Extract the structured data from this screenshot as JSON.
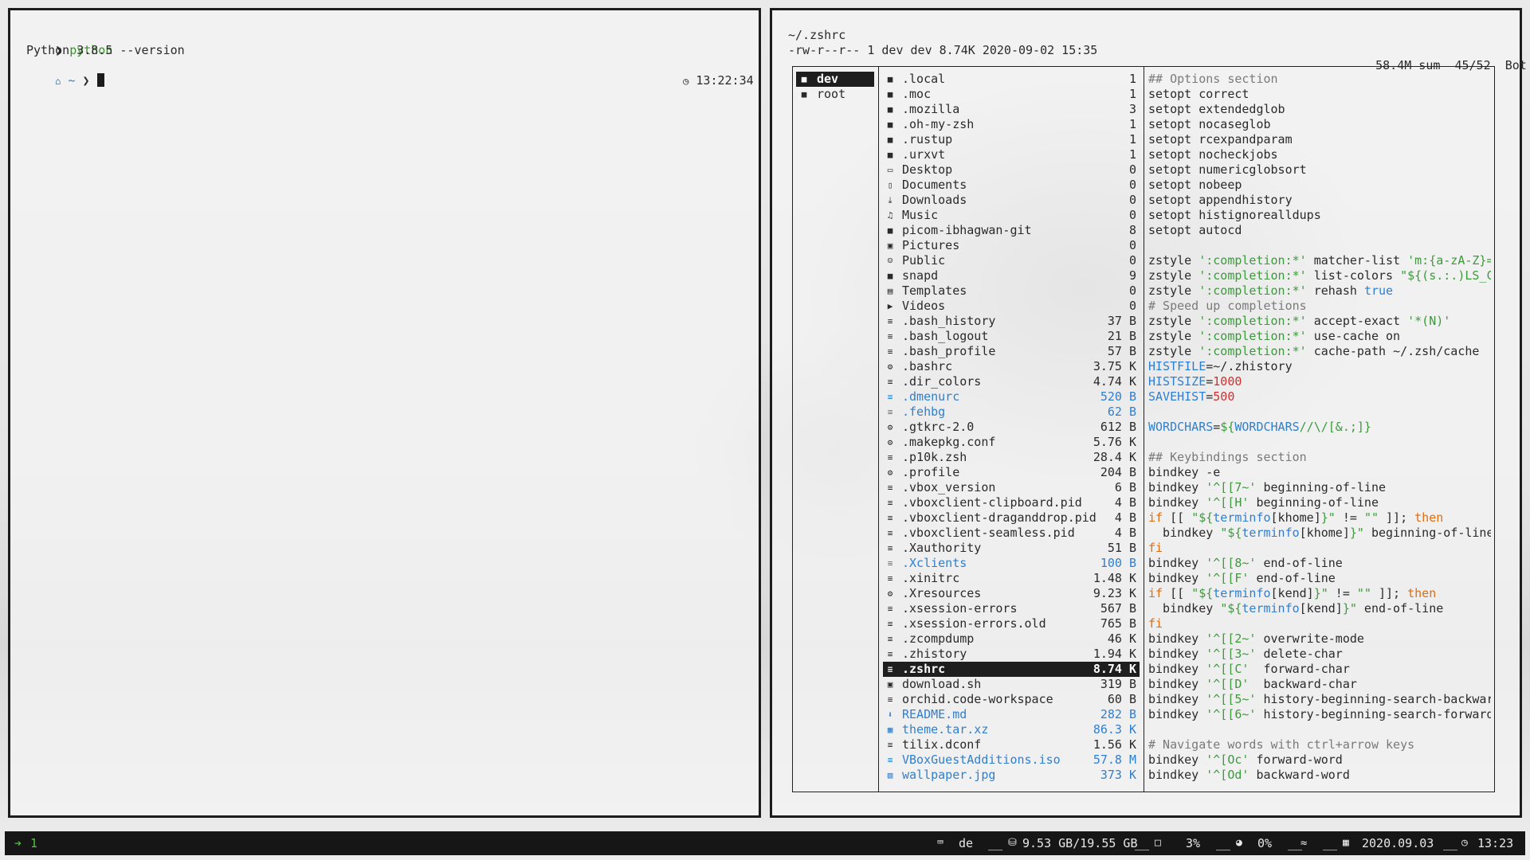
{
  "left_terminal": {
    "prompt_symbol": "❯",
    "command_name": "python",
    "command_args": " --version",
    "output": "Python 3.8.5",
    "home_icon": "home-icon",
    "cwd": "~",
    "clock_icon": "clock-icon",
    "time": "13:22:34"
  },
  "ranger": {
    "path": "~/.zshrc",
    "file_info": "-rw-r--r-- 1 dev dev 8.74K 2020-09-02 15:35",
    "disk_usage": "58.4M sum",
    "position": "45/52",
    "scroll": "Bot",
    "parent_dirs": [
      {
        "name": "dev",
        "selected": true
      },
      {
        "name": "root",
        "selected": false
      }
    ],
    "files": [
      {
        "icon": "folder-icon",
        "name": ".local",
        "size": "1",
        "link": false
      },
      {
        "icon": "folder-icon",
        "name": ".moc",
        "size": "1",
        "link": false
      },
      {
        "icon": "folder-icon",
        "name": ".mozilla",
        "size": "3",
        "link": false
      },
      {
        "icon": "folder-icon",
        "name": ".oh-my-zsh",
        "size": "1",
        "link": false
      },
      {
        "icon": "folder-icon",
        "name": ".rustup",
        "size": "1",
        "link": false
      },
      {
        "icon": "folder-icon",
        "name": ".urxvt",
        "size": "1",
        "link": false
      },
      {
        "icon": "desktop-icon",
        "name": "Desktop",
        "size": "0",
        "link": false
      },
      {
        "icon": "documents-icon",
        "name": "Documents",
        "size": "0",
        "link": false
      },
      {
        "icon": "download-icon",
        "name": "Downloads",
        "size": "0",
        "link": false
      },
      {
        "icon": "music-icon",
        "name": "Music",
        "size": "0",
        "link": false
      },
      {
        "icon": "folder-icon",
        "name": "picom-ibhagwan-git",
        "size": "8",
        "link": false
      },
      {
        "icon": "pictures-icon",
        "name": "Pictures",
        "size": "0",
        "link": false
      },
      {
        "icon": "users-icon",
        "name": "Public",
        "size": "0",
        "link": false
      },
      {
        "icon": "folder-icon",
        "name": "snapd",
        "size": "9",
        "link": false
      },
      {
        "icon": "templates-icon",
        "name": "Templates",
        "size": "0",
        "link": false
      },
      {
        "icon": "video-icon",
        "name": "Videos",
        "size": "0",
        "link": false
      },
      {
        "icon": "file-icon",
        "name": ".bash_history",
        "size": "37 B",
        "link": false
      },
      {
        "icon": "file-icon",
        "name": ".bash_logout",
        "size": "21 B",
        "link": false
      },
      {
        "icon": "file-icon",
        "name": ".bash_profile",
        "size": "57 B",
        "link": false
      },
      {
        "icon": "gear-icon",
        "name": ".bashrc",
        "size": "3.75 K",
        "link": false
      },
      {
        "icon": "file-icon",
        "name": ".dir_colors",
        "size": "4.74 K",
        "link": false
      },
      {
        "icon": "file-icon",
        "name": ".dmenurc",
        "size": "520 B",
        "link": true
      },
      {
        "icon": "file-icon",
        "name": ".fehbg",
        "size": "62 B",
        "link": true
      },
      {
        "icon": "gear-icon",
        "name": ".gtkrc-2.0",
        "size": "612 B",
        "link": false
      },
      {
        "icon": "gear-icon",
        "name": ".makepkg.conf",
        "size": "5.76 K",
        "link": false
      },
      {
        "icon": "file-icon",
        "name": ".p10k.zsh",
        "size": "28.4 K",
        "link": false
      },
      {
        "icon": "gear-icon",
        "name": ".profile",
        "size": "204 B",
        "link": false
      },
      {
        "icon": "file-icon",
        "name": ".vbox_version",
        "size": "6 B",
        "link": false
      },
      {
        "icon": "file-icon",
        "name": ".vboxclient-clipboard.pid",
        "size": "4 B",
        "link": false
      },
      {
        "icon": "file-icon",
        "name": ".vboxclient-draganddrop.pid",
        "size": "4 B",
        "link": false
      },
      {
        "icon": "file-icon",
        "name": ".vboxclient-seamless.pid",
        "size": "4 B",
        "link": false
      },
      {
        "icon": "file-icon",
        "name": ".Xauthority",
        "size": "51 B",
        "link": false
      },
      {
        "icon": "file-icon",
        "name": ".Xclients",
        "size": "100 B",
        "link": true
      },
      {
        "icon": "file-icon",
        "name": ".xinitrc",
        "size": "1.48 K",
        "link": false
      },
      {
        "icon": "gear-icon",
        "name": ".Xresources",
        "size": "9.23 K",
        "link": false
      },
      {
        "icon": "file-icon",
        "name": ".xsession-errors",
        "size": "567 B",
        "link": false
      },
      {
        "icon": "file-icon",
        "name": ".xsession-errors.old",
        "size": "765 B",
        "link": false
      },
      {
        "icon": "file-icon",
        "name": ".zcompdump",
        "size": "46 K",
        "link": false
      },
      {
        "icon": "file-icon",
        "name": ".zhistory",
        "size": "1.94 K",
        "link": false
      },
      {
        "icon": "file-icon",
        "name": ".zshrc",
        "size": "8.74 K",
        "link": false,
        "selected": true
      },
      {
        "icon": "script-icon",
        "name": "download.sh",
        "size": "319 B",
        "link": false
      },
      {
        "icon": "file-icon",
        "name": "orchid.code-workspace",
        "size": "60 B",
        "link": false
      },
      {
        "icon": "markdown-icon",
        "name": "README.md",
        "size": "282 B",
        "link": true
      },
      {
        "icon": "archive-icon",
        "name": "theme.tar.xz",
        "size": "86.3 K",
        "link": true
      },
      {
        "icon": "file-icon",
        "name": "tilix.dconf",
        "size": "1.56 K",
        "link": false
      },
      {
        "icon": "file-icon",
        "name": "VBoxGuestAdditions.iso",
        "size": "57.8 M",
        "link": true
      },
      {
        "icon": "image-icon",
        "name": "wallpaper.jpg",
        "size": "373 K",
        "link": true
      }
    ],
    "preview": [
      [
        [
          "c-comment",
          "## Options section"
        ]
      ],
      [
        [
          "",
          "setopt correct"
        ]
      ],
      [
        [
          "",
          "setopt extendedglob"
        ]
      ],
      [
        [
          "",
          "setopt nocaseglob"
        ]
      ],
      [
        [
          "",
          "setopt rcexpandparam"
        ]
      ],
      [
        [
          "",
          "setopt nocheckjobs"
        ]
      ],
      [
        [
          "",
          "setopt numericglobsort"
        ]
      ],
      [
        [
          "",
          "setopt nobeep"
        ]
      ],
      [
        [
          "",
          "setopt appendhistory"
        ]
      ],
      [
        [
          "",
          "setopt histignorealldups"
        ]
      ],
      [
        [
          "",
          "setopt autocd"
        ]
      ],
      [],
      [
        [
          "",
          "zstyle "
        ],
        [
          "c-str",
          "':completion:*'"
        ],
        [
          "",
          " matcher-list "
        ],
        [
          "c-str",
          "'m:{a-zA-Z}="
        ]
      ],
      [
        [
          "",
          "zstyle "
        ],
        [
          "c-str",
          "':completion:*'"
        ],
        [
          "",
          " list-colors "
        ],
        [
          "c-str",
          "\"${(s.:.)LS_C"
        ]
      ],
      [
        [
          "",
          "zstyle "
        ],
        [
          "c-str",
          "':completion:*'"
        ],
        [
          "",
          " rehash "
        ],
        [
          "c-bool",
          "true"
        ]
      ],
      [
        [
          "c-comment",
          "# Speed up completions"
        ]
      ],
      [
        [
          "",
          "zstyle "
        ],
        [
          "c-str",
          "':completion:*'"
        ],
        [
          "",
          " accept-exact "
        ],
        [
          "c-str",
          "'*(N)'"
        ]
      ],
      [
        [
          "",
          "zstyle "
        ],
        [
          "c-str",
          "':completion:*'"
        ],
        [
          "",
          " use-cache on"
        ]
      ],
      [
        [
          "",
          "zstyle "
        ],
        [
          "c-str",
          "':completion:*'"
        ],
        [
          "",
          " cache-path ~/.zsh/cache"
        ]
      ],
      [
        [
          "c-var",
          "HISTFILE"
        ],
        [
          "",
          "=~/.zhistory"
        ]
      ],
      [
        [
          "c-var",
          "HISTSIZE"
        ],
        [
          "",
          "="
        ],
        [
          "c-num",
          "1000"
        ]
      ],
      [
        [
          "c-var",
          "SAVEHIST"
        ],
        [
          "",
          "="
        ],
        [
          "c-num",
          "500"
        ]
      ],
      [],
      [
        [
          "c-var",
          "WORDCHARS"
        ],
        [
          "",
          "="
        ],
        [
          "c-str",
          "${"
        ],
        [
          "c-var",
          "WORDCHARS"
        ],
        [
          "c-str",
          "//\\/[&.;]}"
        ]
      ],
      [],
      [
        [
          "c-comment",
          "## Keybindings section"
        ]
      ],
      [
        [
          "",
          "bindkey -e"
        ]
      ],
      [
        [
          "",
          "bindkey "
        ],
        [
          "c-str",
          "'^[[7~'"
        ],
        [
          "",
          " beginning-of-line"
        ]
      ],
      [
        [
          "",
          "bindkey "
        ],
        [
          "c-str",
          "'^[[H'"
        ],
        [
          "",
          " beginning-of-line"
        ]
      ],
      [
        [
          "c-kw",
          "if"
        ],
        [
          "",
          " [[ "
        ],
        [
          "c-str",
          "\"${"
        ],
        [
          "c-var",
          "terminfo"
        ],
        [
          "",
          "[khome]"
        ],
        [
          "c-str",
          "}\""
        ],
        [
          "",
          " != "
        ],
        [
          "c-str",
          "\"\""
        ],
        [
          "",
          " ]]; "
        ],
        [
          "c-kw",
          "then"
        ]
      ],
      [
        [
          "",
          "  bindkey "
        ],
        [
          "c-str",
          "\"${"
        ],
        [
          "c-var",
          "terminfo"
        ],
        [
          "",
          "[khome]"
        ],
        [
          "c-str",
          "}\""
        ],
        [
          "",
          " beginning-of-line"
        ]
      ],
      [
        [
          "c-kw",
          "fi"
        ]
      ],
      [
        [
          "",
          "bindkey "
        ],
        [
          "c-str",
          "'^[[8~'"
        ],
        [
          "",
          " end-of-line"
        ]
      ],
      [
        [
          "",
          "bindkey "
        ],
        [
          "c-str",
          "'^[[F'"
        ],
        [
          "",
          " end-of-line"
        ]
      ],
      [
        [
          "c-kw",
          "if"
        ],
        [
          "",
          " [[ "
        ],
        [
          "c-str",
          "\"${"
        ],
        [
          "c-var",
          "terminfo"
        ],
        [
          "",
          "[kend]"
        ],
        [
          "c-str",
          "}\""
        ],
        [
          "",
          " != "
        ],
        [
          "c-str",
          "\"\""
        ],
        [
          "",
          " ]]; "
        ],
        [
          "c-kw",
          "then"
        ]
      ],
      [
        [
          "",
          "  bindkey "
        ],
        [
          "c-str",
          "\"${"
        ],
        [
          "c-var",
          "terminfo"
        ],
        [
          "",
          "[kend]"
        ],
        [
          "c-str",
          "}\""
        ],
        [
          "",
          " end-of-line"
        ]
      ],
      [
        [
          "c-kw",
          "fi"
        ]
      ],
      [
        [
          "",
          "bindkey "
        ],
        [
          "c-str",
          "'^[[2~'"
        ],
        [
          "",
          " overwrite-mode"
        ]
      ],
      [
        [
          "",
          "bindkey "
        ],
        [
          "c-str",
          "'^[[3~'"
        ],
        [
          "",
          " delete-char"
        ]
      ],
      [
        [
          "",
          "bindkey "
        ],
        [
          "c-str",
          "'^[[C'"
        ],
        [
          "",
          "  forward-char"
        ]
      ],
      [
        [
          "",
          "bindkey "
        ],
        [
          "c-str",
          "'^[[D'"
        ],
        [
          "",
          "  backward-char"
        ]
      ],
      [
        [
          "",
          "bindkey "
        ],
        [
          "c-str",
          "'^[[5~'"
        ],
        [
          "",
          " history-beginning-search-backwar"
        ]
      ],
      [
        [
          "",
          "bindkey "
        ],
        [
          "c-str",
          "'^[[6~'"
        ],
        [
          "",
          " history-beginning-search-forward"
        ]
      ],
      [],
      [
        [
          "c-comment",
          "# Navigate words with ctrl+arrow keys"
        ]
      ],
      [
        [
          "",
          "bindkey "
        ],
        [
          "c-str",
          "'^[Oc'"
        ],
        [
          "",
          " forward-word"
        ]
      ],
      [
        [
          "",
          "bindkey "
        ],
        [
          "c-str",
          "'^[Od'"
        ],
        [
          "",
          " backward-word"
        ]
      ]
    ]
  },
  "statusbar": {
    "workspace_icon": "arrow-right-icon",
    "workspace": "1",
    "keyboard_icon": "keyboard-icon",
    "keyboard_layout": "de",
    "sep1": "__",
    "disk_icon": "database-icon",
    "disk": "9.53 GB/19.55 GB",
    "sep2": "__",
    "cpu_icon": "cpu-icon",
    "cpu": "3%",
    "sep3": "__",
    "gauge_icon": "gauge-icon",
    "mem": "0%",
    "sep4": "__",
    "wifi_icon": "wifi-icon",
    "sep5": "__",
    "calendar_icon": "calendar-icon",
    "date": "2020.09.03",
    "sep6": "__",
    "clock_icon": "clock-icon",
    "time": "13:23"
  }
}
